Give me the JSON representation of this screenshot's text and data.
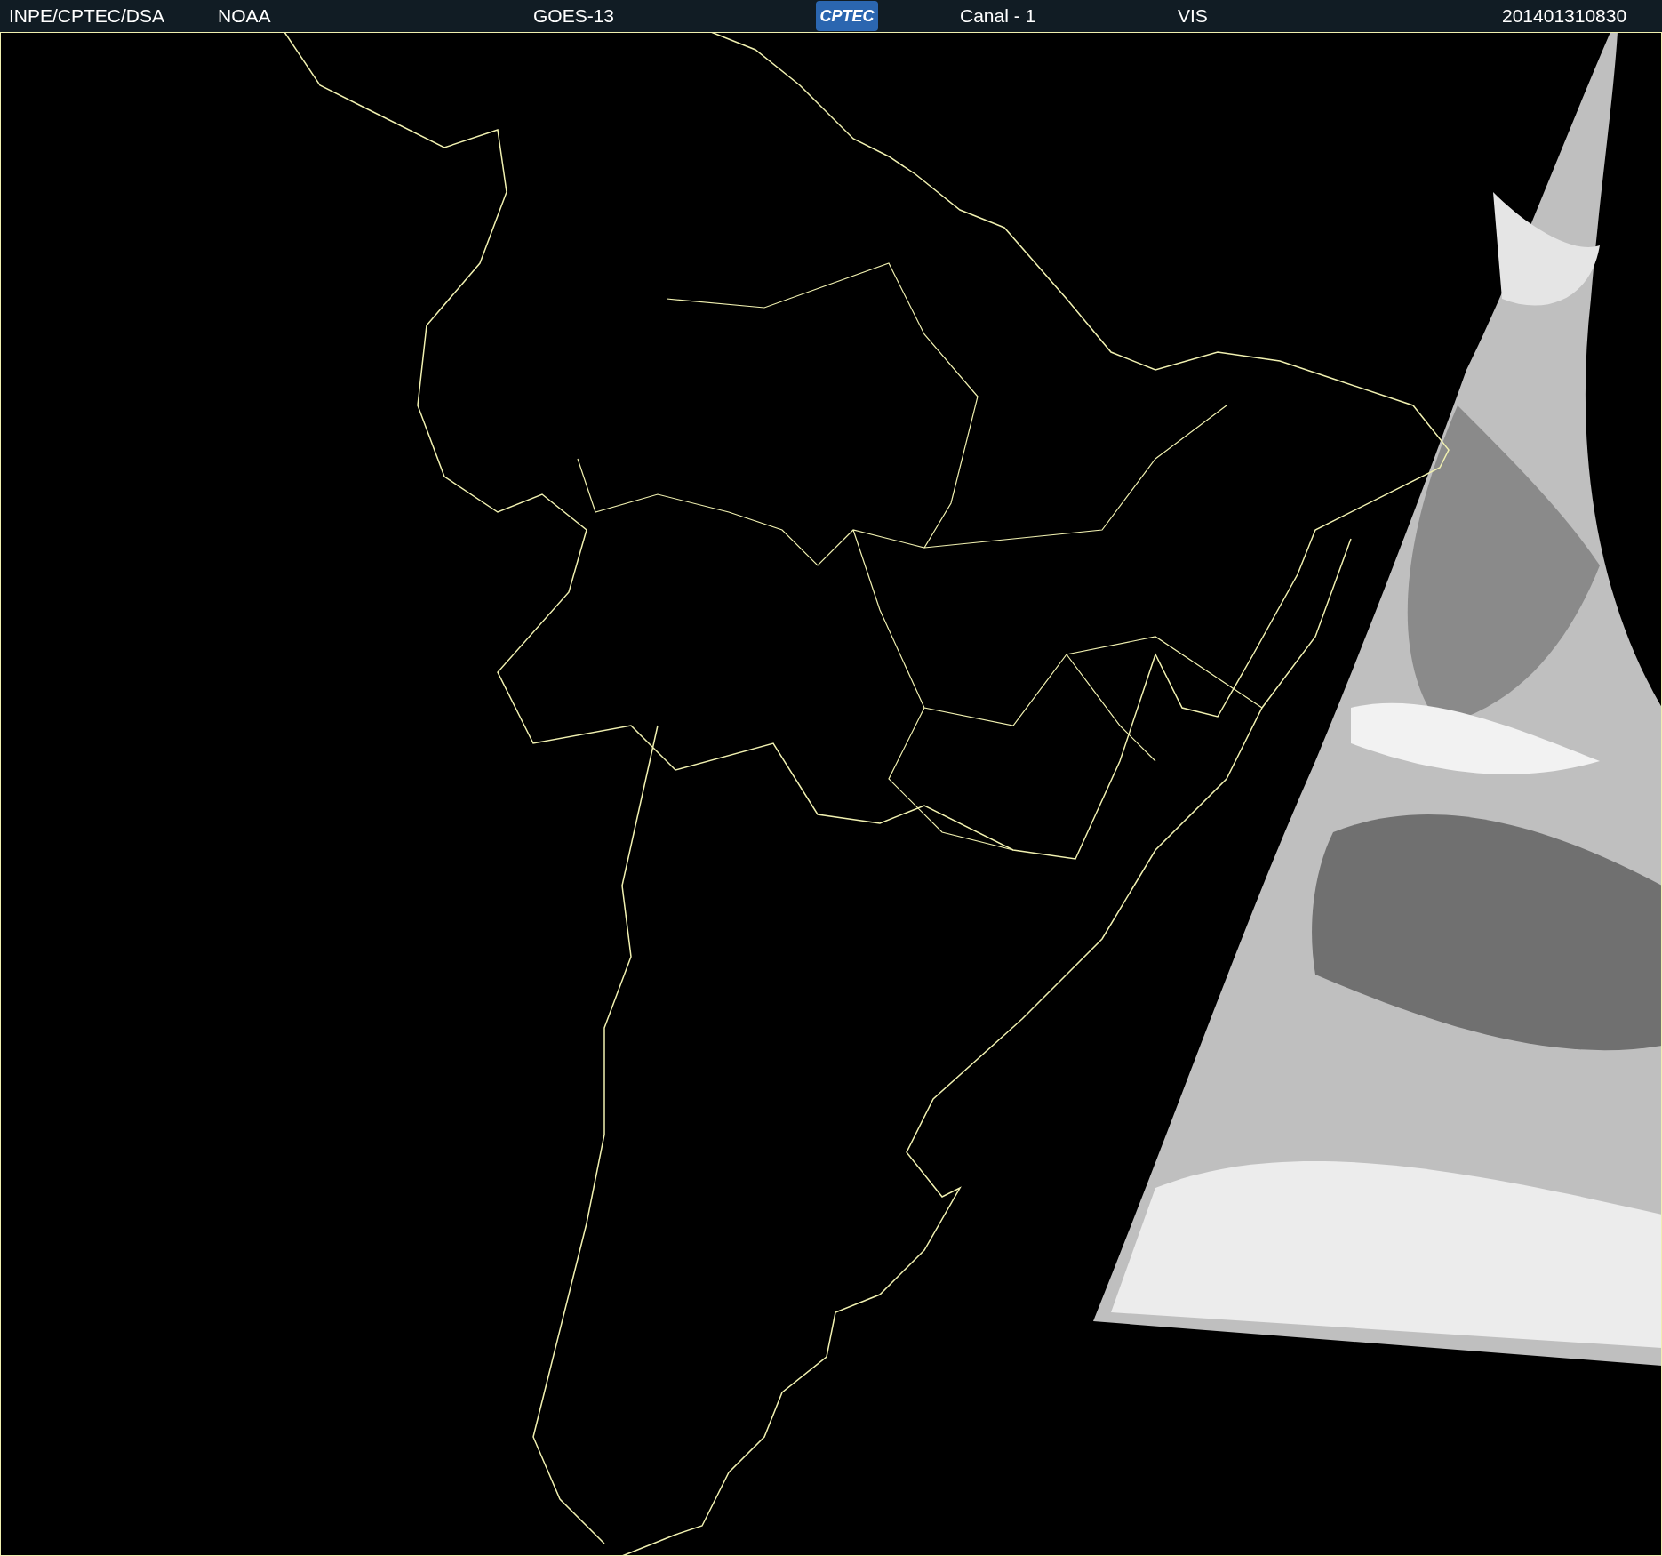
{
  "header": {
    "source": "INPE/CPTEC/DSA",
    "agency": "NOAA",
    "satellite": "GOES-13",
    "logo_text": "CPTEC",
    "channel": "Canal - 1",
    "band": "VIS",
    "timestamp": "201401310830"
  }
}
